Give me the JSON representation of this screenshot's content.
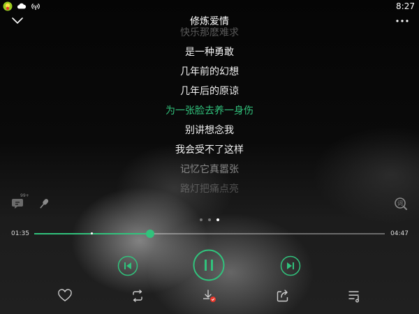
{
  "status_bar": {
    "time": "8:27",
    "icons": [
      "app-badge-icon",
      "cloud-icon",
      "signal-broadcast-icon"
    ]
  },
  "header": {
    "title": "修炼爱情",
    "left_icon": "chevron-down-icon",
    "right_icon": "more-dots-icon"
  },
  "lyrics": {
    "lines": [
      {
        "text": "快乐那麽难求",
        "state": "fade-top"
      },
      {
        "text": "是一种勇敢",
        "state": "normal"
      },
      {
        "text": "几年前的幻想",
        "state": "normal"
      },
      {
        "text": "几年后的原谅",
        "state": "normal"
      },
      {
        "text": "为一张脸去养一身伤",
        "state": "active"
      },
      {
        "text": "别讲想念我",
        "state": "normal"
      },
      {
        "text": "我会受不了这样",
        "state": "normal"
      },
      {
        "text": "记忆它真嚣张",
        "state": "dim"
      },
      {
        "text": "路灯把痛点亮",
        "state": "fade-bottom"
      }
    ],
    "active_color": "#31c27c"
  },
  "side_buttons": {
    "left": [
      "comment-99-icon",
      "microphone-icon"
    ],
    "right": "lyrics-search-icon",
    "comment_badge": "99+"
  },
  "pager": {
    "count": 3,
    "active_index": 2
  },
  "progress": {
    "current_time": "01:35",
    "total_time": "04:47",
    "fraction": 0.33,
    "accent": "#31c27c"
  },
  "controls": {
    "previous": "previous-track-icon",
    "play_pause": "pause-icon",
    "next": "next-track-icon"
  },
  "actions": [
    "heart-icon",
    "repeat-icon",
    "download-icon",
    "share-icon",
    "playlist-icon"
  ]
}
